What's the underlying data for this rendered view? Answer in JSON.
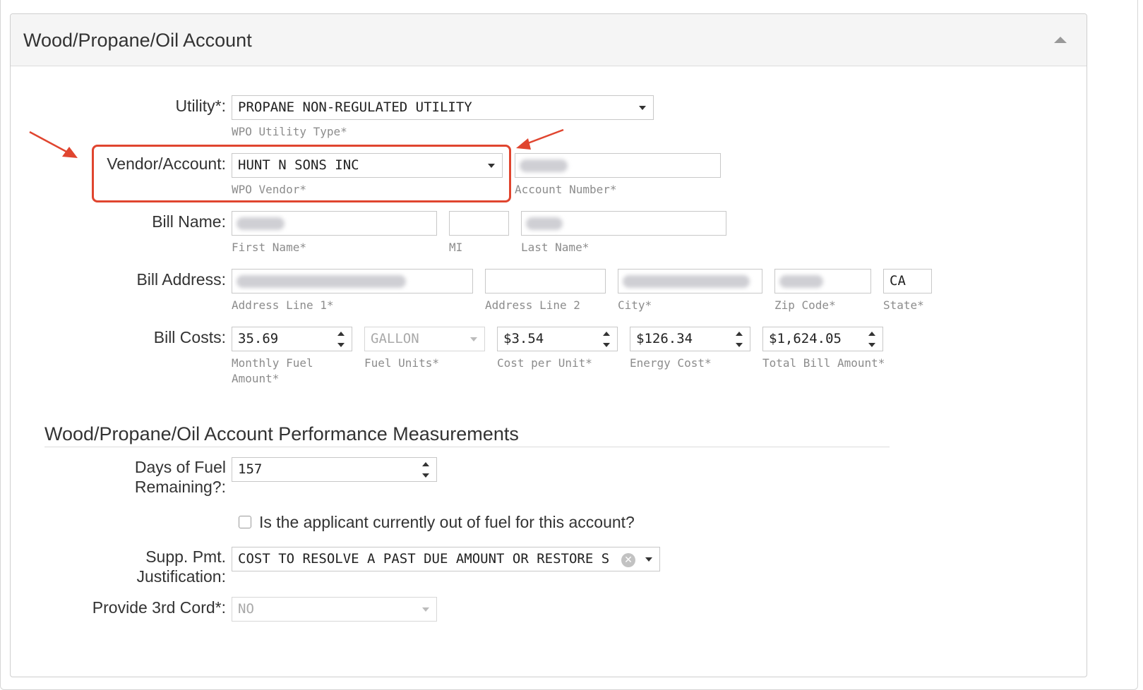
{
  "panel": {
    "title": "Wood/Propane/Oil Account"
  },
  "utility": {
    "label": "Utility*:",
    "value": "PROPANE NON-REGULATED UTILITY",
    "help": "WPO Utility Type*"
  },
  "vendor": {
    "label": "Vendor/Account:",
    "value": "HUNT N SONS INC",
    "help": "WPO Vendor*",
    "account_help": "Account Number*"
  },
  "bill_name": {
    "label": "Bill Name:",
    "first_help": "First Name*",
    "mi_help": "MI",
    "last_help": "Last Name*"
  },
  "bill_address": {
    "label": "Bill Address:",
    "line1_help": "Address Line 1*",
    "line2_help": "Address Line 2",
    "city_help": "City*",
    "zip_help": "Zip Code*",
    "state_value": "CA",
    "state_help": "State*"
  },
  "bill_costs": {
    "label": "Bill Costs:",
    "monthly_fuel_value": "35.69",
    "monthly_fuel_help_1": "Monthly Fuel",
    "monthly_fuel_help_2": "Amount*",
    "fuel_units_value": "GALLON",
    "fuel_units_help": "Fuel Units*",
    "cost_per_unit_value": "$3.54",
    "cost_per_unit_help": "Cost per Unit*",
    "energy_cost_value": "$126.34",
    "energy_cost_help": "Energy Cost*",
    "total_bill_value": "$1,624.05",
    "total_bill_help": "Total Bill Amount*"
  },
  "performance": {
    "heading": "Wood/Propane/Oil Account Performance Measurements",
    "days_label_1": "Days of Fuel",
    "days_label_2": "Remaining?:",
    "days_value": "157",
    "out_of_fuel_label": "Is the applicant currently out of fuel for this account?",
    "out_of_fuel_checked": false,
    "supp_label_1": "Supp. Pmt.",
    "supp_label_2": "Justification:",
    "supp_value": "COST TO RESOLVE A PAST DUE AMOUNT OR RESTORE S",
    "third_cord_label": "Provide 3rd Cord*:",
    "third_cord_value": "NO"
  },
  "colors": {
    "annotation": "#e0452f",
    "header_bg": "#f5f5f5"
  }
}
